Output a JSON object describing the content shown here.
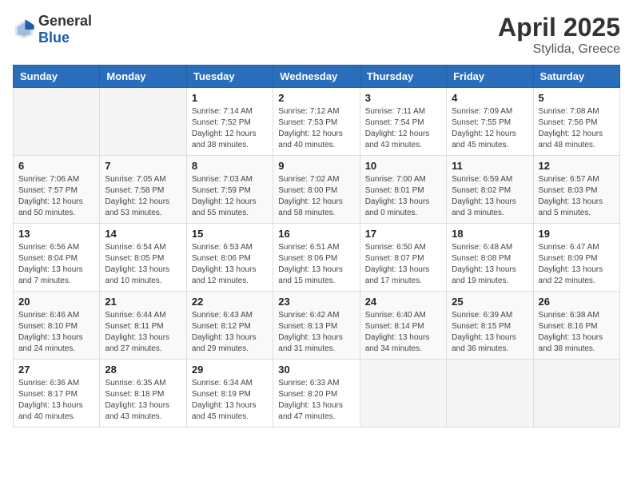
{
  "header": {
    "logo_general": "General",
    "logo_blue": "Blue",
    "month": "April 2025",
    "location": "Stylida, Greece"
  },
  "weekdays": [
    "Sunday",
    "Monday",
    "Tuesday",
    "Wednesday",
    "Thursday",
    "Friday",
    "Saturday"
  ],
  "weeks": [
    [
      {
        "day": "",
        "info": ""
      },
      {
        "day": "",
        "info": ""
      },
      {
        "day": "1",
        "info": "Sunrise: 7:14 AM\nSunset: 7:52 PM\nDaylight: 12 hours and 38 minutes."
      },
      {
        "day": "2",
        "info": "Sunrise: 7:12 AM\nSunset: 7:53 PM\nDaylight: 12 hours and 40 minutes."
      },
      {
        "day": "3",
        "info": "Sunrise: 7:11 AM\nSunset: 7:54 PM\nDaylight: 12 hours and 43 minutes."
      },
      {
        "day": "4",
        "info": "Sunrise: 7:09 AM\nSunset: 7:55 PM\nDaylight: 12 hours and 45 minutes."
      },
      {
        "day": "5",
        "info": "Sunrise: 7:08 AM\nSunset: 7:56 PM\nDaylight: 12 hours and 48 minutes."
      }
    ],
    [
      {
        "day": "6",
        "info": "Sunrise: 7:06 AM\nSunset: 7:57 PM\nDaylight: 12 hours and 50 minutes."
      },
      {
        "day": "7",
        "info": "Sunrise: 7:05 AM\nSunset: 7:58 PM\nDaylight: 12 hours and 53 minutes."
      },
      {
        "day": "8",
        "info": "Sunrise: 7:03 AM\nSunset: 7:59 PM\nDaylight: 12 hours and 55 minutes."
      },
      {
        "day": "9",
        "info": "Sunrise: 7:02 AM\nSunset: 8:00 PM\nDaylight: 12 hours and 58 minutes."
      },
      {
        "day": "10",
        "info": "Sunrise: 7:00 AM\nSunset: 8:01 PM\nDaylight: 13 hours and 0 minutes."
      },
      {
        "day": "11",
        "info": "Sunrise: 6:59 AM\nSunset: 8:02 PM\nDaylight: 13 hours and 3 minutes."
      },
      {
        "day": "12",
        "info": "Sunrise: 6:57 AM\nSunset: 8:03 PM\nDaylight: 13 hours and 5 minutes."
      }
    ],
    [
      {
        "day": "13",
        "info": "Sunrise: 6:56 AM\nSunset: 8:04 PM\nDaylight: 13 hours and 7 minutes."
      },
      {
        "day": "14",
        "info": "Sunrise: 6:54 AM\nSunset: 8:05 PM\nDaylight: 13 hours and 10 minutes."
      },
      {
        "day": "15",
        "info": "Sunrise: 6:53 AM\nSunset: 8:06 PM\nDaylight: 13 hours and 12 minutes."
      },
      {
        "day": "16",
        "info": "Sunrise: 6:51 AM\nSunset: 8:06 PM\nDaylight: 13 hours and 15 minutes."
      },
      {
        "day": "17",
        "info": "Sunrise: 6:50 AM\nSunset: 8:07 PM\nDaylight: 13 hours and 17 minutes."
      },
      {
        "day": "18",
        "info": "Sunrise: 6:48 AM\nSunset: 8:08 PM\nDaylight: 13 hours and 19 minutes."
      },
      {
        "day": "19",
        "info": "Sunrise: 6:47 AM\nSunset: 8:09 PM\nDaylight: 13 hours and 22 minutes."
      }
    ],
    [
      {
        "day": "20",
        "info": "Sunrise: 6:46 AM\nSunset: 8:10 PM\nDaylight: 13 hours and 24 minutes."
      },
      {
        "day": "21",
        "info": "Sunrise: 6:44 AM\nSunset: 8:11 PM\nDaylight: 13 hours and 27 minutes."
      },
      {
        "day": "22",
        "info": "Sunrise: 6:43 AM\nSunset: 8:12 PM\nDaylight: 13 hours and 29 minutes."
      },
      {
        "day": "23",
        "info": "Sunrise: 6:42 AM\nSunset: 8:13 PM\nDaylight: 13 hours and 31 minutes."
      },
      {
        "day": "24",
        "info": "Sunrise: 6:40 AM\nSunset: 8:14 PM\nDaylight: 13 hours and 34 minutes."
      },
      {
        "day": "25",
        "info": "Sunrise: 6:39 AM\nSunset: 8:15 PM\nDaylight: 13 hours and 36 minutes."
      },
      {
        "day": "26",
        "info": "Sunrise: 6:38 AM\nSunset: 8:16 PM\nDaylight: 13 hours and 38 minutes."
      }
    ],
    [
      {
        "day": "27",
        "info": "Sunrise: 6:36 AM\nSunset: 8:17 PM\nDaylight: 13 hours and 40 minutes."
      },
      {
        "day": "28",
        "info": "Sunrise: 6:35 AM\nSunset: 8:18 PM\nDaylight: 13 hours and 43 minutes."
      },
      {
        "day": "29",
        "info": "Sunrise: 6:34 AM\nSunset: 8:19 PM\nDaylight: 13 hours and 45 minutes."
      },
      {
        "day": "30",
        "info": "Sunrise: 6:33 AM\nSunset: 8:20 PM\nDaylight: 13 hours and 47 minutes."
      },
      {
        "day": "",
        "info": ""
      },
      {
        "day": "",
        "info": ""
      },
      {
        "day": "",
        "info": ""
      }
    ]
  ]
}
